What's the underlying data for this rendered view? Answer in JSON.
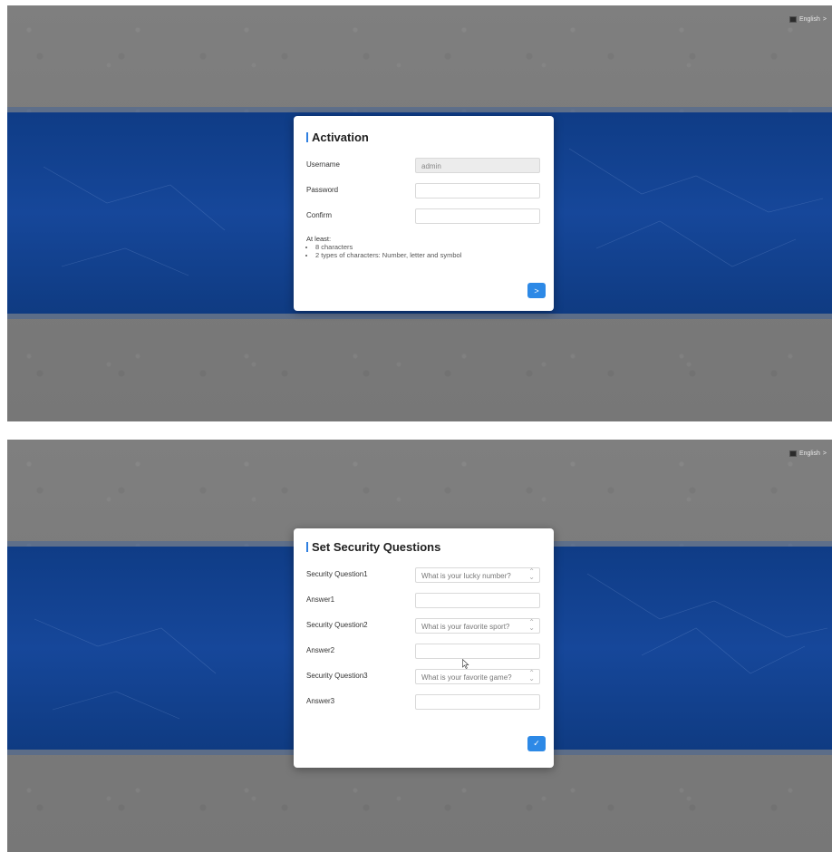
{
  "screens": [
    {
      "language": "English",
      "language_chevron": ">",
      "title": "Activation",
      "fields": [
        {
          "label": "Username",
          "value": "admin",
          "disabled": true
        },
        {
          "label": "Password",
          "value": ""
        },
        {
          "label": "Confirm",
          "value": ""
        }
      ],
      "hint": {
        "title": "At least:",
        "items": [
          "8 characters",
          "2 types of characters: Number, letter and symbol"
        ]
      },
      "next_button": ">"
    },
    {
      "language": "English",
      "language_chevron": ">",
      "title": "Set Security Questions",
      "rows": [
        {
          "label": "Security Question1",
          "value": "What is your lucky number?"
        },
        {
          "label": "Answer1",
          "value": ""
        },
        {
          "label": "Security Question2",
          "value": "What is your favorite sport?"
        },
        {
          "label": "Answer2",
          "value": ""
        },
        {
          "label": "Security Question3",
          "value": "What is your favorite game?"
        },
        {
          "label": "Answer3",
          "value": ""
        }
      ],
      "confirm_button": "✓"
    }
  ],
  "colors": {
    "accent": "#2d89e6",
    "band": "#16479a",
    "backdrop": "#7b7b7b"
  },
  "icons": [
    "language-flag-icon",
    "chevron-right-icon",
    "select-arrows-icon",
    "next-arrow-icon",
    "checkmark-icon"
  ]
}
